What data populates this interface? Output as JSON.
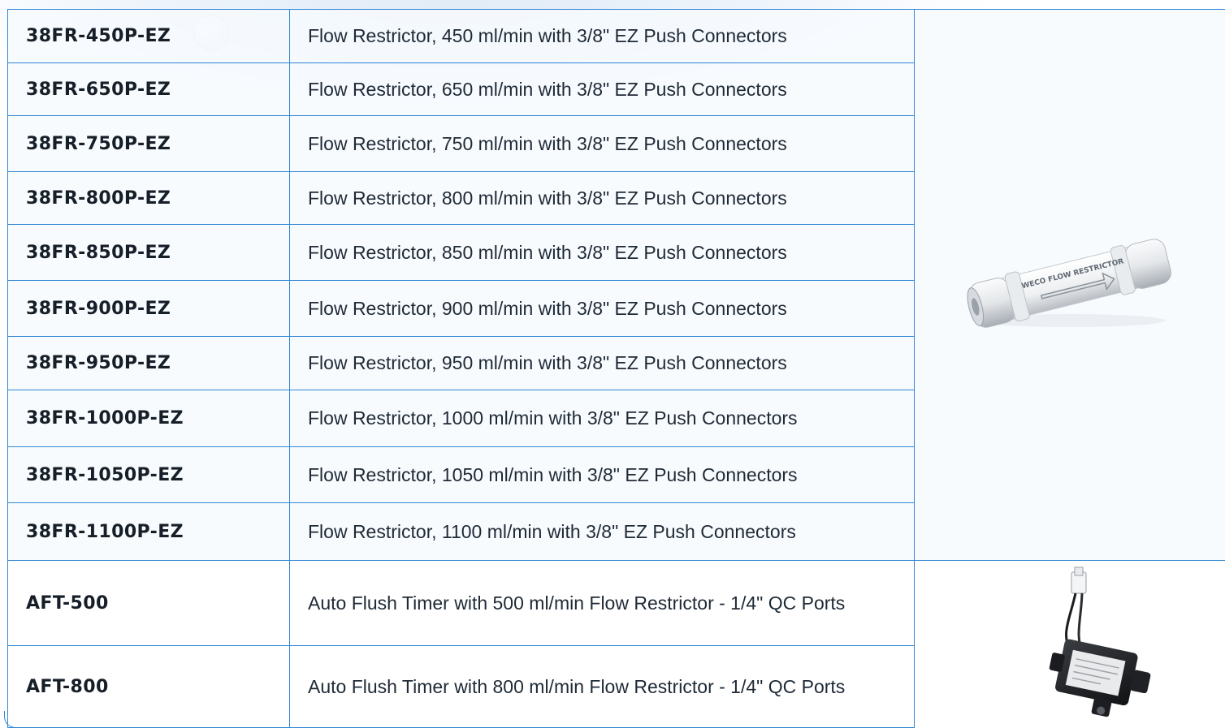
{
  "rows": [
    {
      "sku": "38FR-450P-EZ",
      "description": "Flow Restrictor, 450 ml/min with 3/8\" EZ Push Connectors"
    },
    {
      "sku": "38FR-650P-EZ",
      "description": "Flow Restrictor, 650 ml/min with 3/8\" EZ Push Connectors"
    },
    {
      "sku": "38FR-750P-EZ",
      "description": "Flow Restrictor, 750 ml/min with 3/8\" EZ Push Connectors"
    },
    {
      "sku": "38FR-800P-EZ",
      "description": "Flow Restrictor, 800 ml/min with 3/8\" EZ Push Connectors"
    },
    {
      "sku": "38FR-850P-EZ",
      "description": "Flow Restrictor, 850 ml/min with 3/8\" EZ Push Connectors"
    },
    {
      "sku": "38FR-900P-EZ",
      "description": "Flow Restrictor, 900 ml/min with 3/8\" EZ Push Connectors"
    },
    {
      "sku": "38FR-950P-EZ",
      "description": "Flow Restrictor, 950 ml/min with 3/8\" EZ Push Connectors"
    },
    {
      "sku": "38FR-1000P-EZ",
      "description": "Flow Restrictor, 1000 ml/min with 3/8\" EZ Push Connectors"
    },
    {
      "sku": "38FR-1050P-EZ",
      "description": "Flow Restrictor, 1050 ml/min with 3/8\" EZ Push Connectors"
    },
    {
      "sku": "38FR-1100P-EZ",
      "description": "Flow Restrictor, 1100 ml/min with 3/8\" EZ Push Connectors"
    },
    {
      "sku": "AFT-500",
      "description": "Auto Flush Timer with 500 ml/min Flow Restrictor - 1/4\" QC Ports"
    },
    {
      "sku": "AFT-800",
      "description": "Auto Flush Timer with 800 ml/min Flow Restrictor - 1/4\" QC Ports"
    }
  ],
  "images": {
    "flow_restrictor": {
      "icon": "flow-restrictor-product-photo",
      "imprint": "WECO FLOW RESTRICTOR"
    },
    "auto_flush_timer": {
      "icon": "auto-flush-timer-product-photo"
    }
  },
  "colors": {
    "border": "#2f86d6",
    "text": "#1f2a36",
    "row_background": "#f6fafe"
  }
}
